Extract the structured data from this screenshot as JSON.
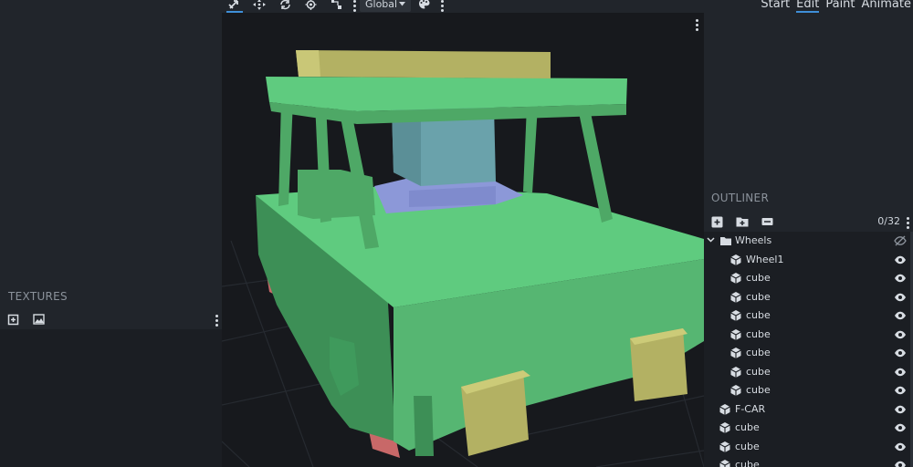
{
  "toolbar": {
    "space_select": "Global",
    "active_tool": "move-tool"
  },
  "modes": {
    "start": "Start",
    "edit": "Edit",
    "paint": "Paint",
    "animate": "Animate",
    "active": "Edit"
  },
  "textures": {
    "title": "TEXTURES"
  },
  "outliner": {
    "title": "OUTLINER",
    "count": "0/32",
    "rows": [
      {
        "label": "Wheels",
        "type": "group",
        "expanded": true,
        "visible": false
      },
      {
        "label": "Wheel1",
        "type": "cube",
        "visible": true
      },
      {
        "label": "cube",
        "type": "cube",
        "visible": true
      },
      {
        "label": "cube",
        "type": "cube",
        "visible": true
      },
      {
        "label": "cube",
        "type": "cube",
        "visible": true
      },
      {
        "label": "cube",
        "type": "cube",
        "visible": true
      },
      {
        "label": "cube",
        "type": "cube",
        "visible": true
      },
      {
        "label": "cube",
        "type": "cube",
        "visible": true
      },
      {
        "label": "cube",
        "type": "cube",
        "visible": true
      },
      {
        "label": "F-CAR",
        "type": "cube",
        "visible": true
      },
      {
        "label": "cube",
        "type": "cube",
        "visible": true
      },
      {
        "label": "cube",
        "type": "cube",
        "visible": true
      },
      {
        "label": "cube",
        "type": "cube",
        "visible": true
      }
    ]
  },
  "colors": {
    "accent": "#3f8fd8",
    "body_green": "#5fcb7f",
    "roof_yellow": "#b5b46a",
    "window_blue": "#6a9fa8",
    "seat_purple": "#8b97d6",
    "wheel_red": "#cf6e6e"
  }
}
